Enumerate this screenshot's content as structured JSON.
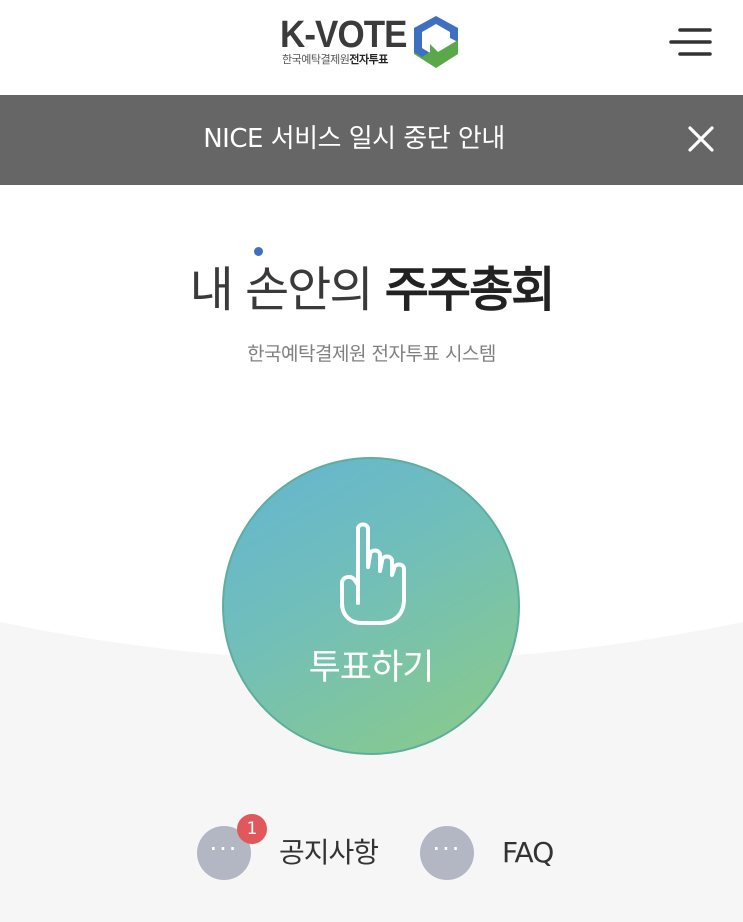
{
  "header": {
    "logo_text": "K-VOTE",
    "logo_sub_main": "한국예탁결제원",
    "logo_sub_bold": "전자투표",
    "menu_icon": "hamburger-menu-icon"
  },
  "notice": {
    "text": "NICE 서비스 일시 중단 안내",
    "close_icon": "close-icon",
    "background": "#666666"
  },
  "hero": {
    "title_light": "내 손안의",
    "title_bold": "주주총회",
    "subtitle": "한국예탁결제원 전자투표 시스템",
    "dot_color": "#3f6fc0"
  },
  "vote_button": {
    "label": "투표하기",
    "icon": "pointing-hand-icon",
    "gradient": [
      "#63b5d3",
      "#72bfb8",
      "#8ccb86"
    ]
  },
  "links": {
    "notice": {
      "label": "공지사항",
      "icon_text": "···",
      "badge": "1"
    },
    "faq": {
      "label": "FAQ",
      "icon_text": "···"
    }
  },
  "colors": {
    "badge": "#e0585c",
    "link_circle": "#b3b7c3",
    "brand_green": "#5aa84a",
    "brand_blue": "#3f6fc0"
  }
}
